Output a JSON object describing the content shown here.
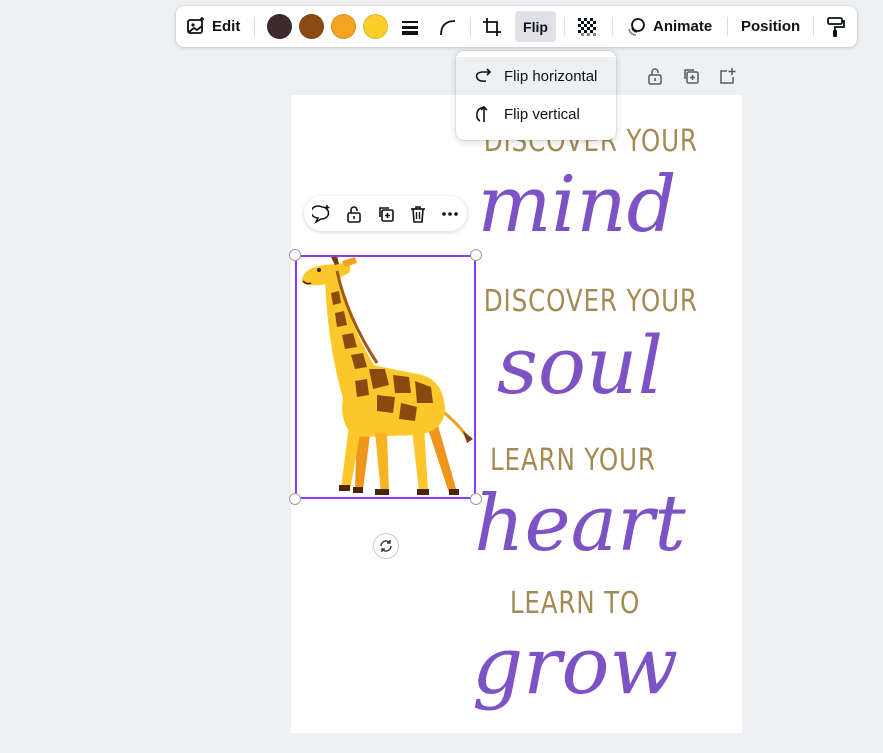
{
  "toolbar": {
    "edit_label": "Edit",
    "flip_label": "Flip",
    "animate_label": "Animate",
    "position_label": "Position",
    "colors": [
      "#3d2a2a",
      "#8b4a12",
      "#f5a323",
      "#fbcf2a"
    ]
  },
  "flip_menu": {
    "items": [
      {
        "label": "Flip horizontal",
        "icon": "flip-horizontal-icon"
      },
      {
        "label": "Flip vertical",
        "icon": "flip-vertical-icon"
      }
    ]
  },
  "poster": {
    "line1": "DISCOVER YOUR",
    "word1": "mind",
    "line2": "DISCOVER YOUR",
    "word2": "soul",
    "line3": "LEARN YOUR",
    "word3": "heart",
    "line4": "LEARN TO",
    "word4": "grow",
    "text_color": "#a58a55",
    "script_color": "#7d52c4"
  },
  "selection_color": "#8b3dff"
}
